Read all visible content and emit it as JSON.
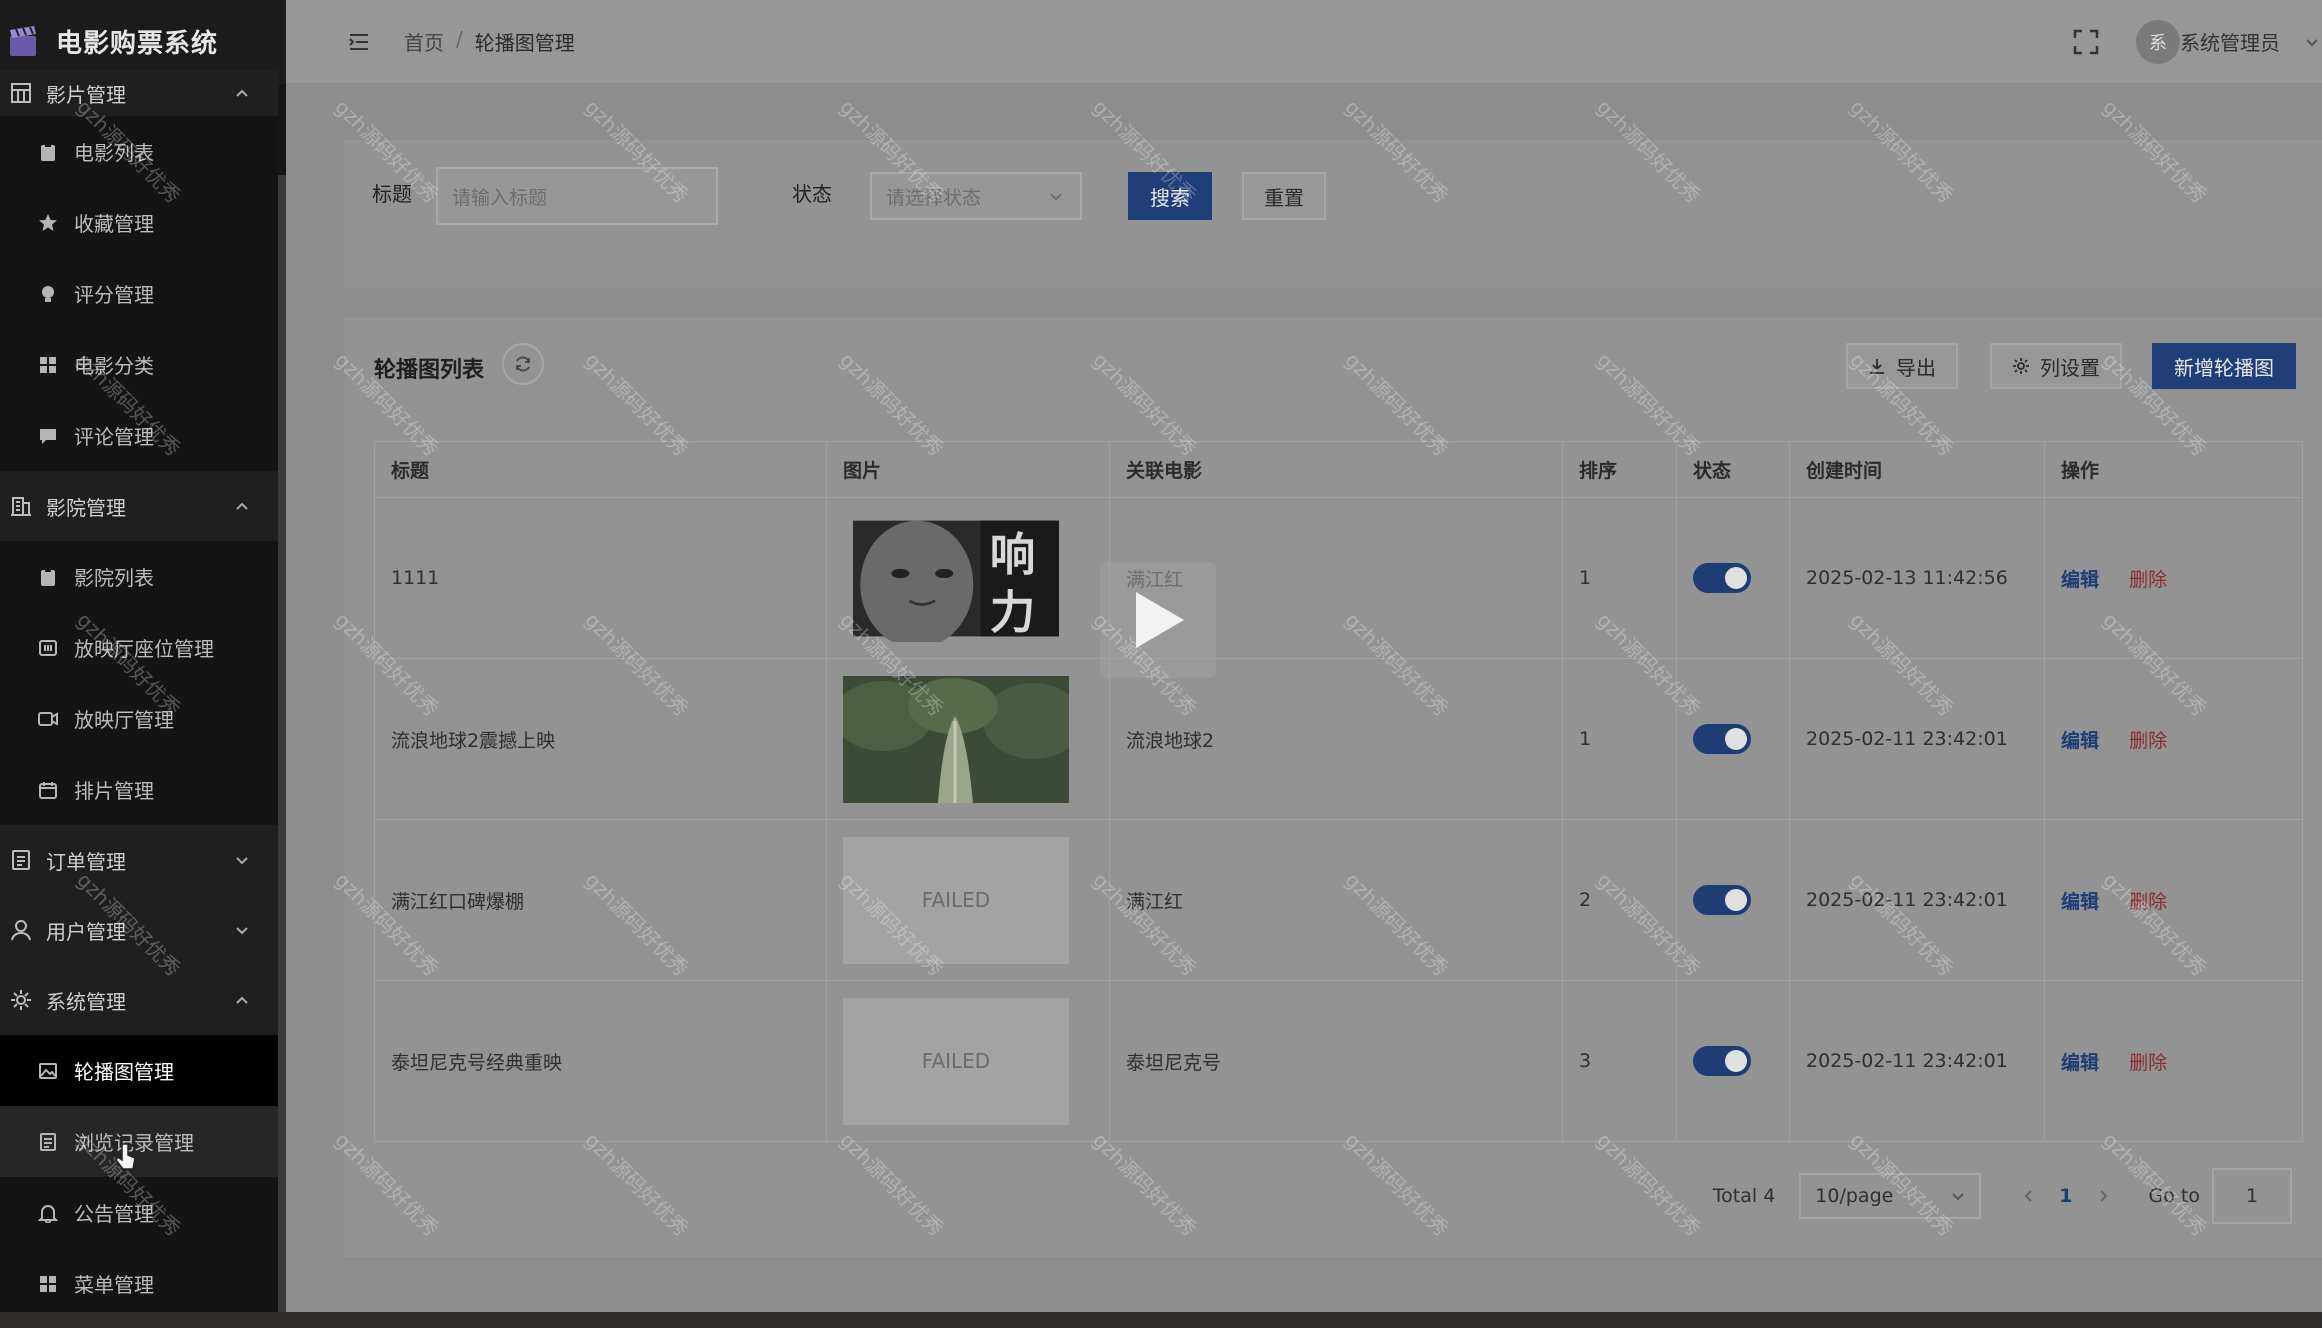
{
  "app": {
    "title": "电影购票系统"
  },
  "sidebar": {
    "groups": [
      {
        "label": "影片管理",
        "icon": "grid-icon",
        "expanded": true,
        "items": [
          {
            "label": "电影列表",
            "icon": "clipboard-icon"
          },
          {
            "label": "收藏管理",
            "icon": "star-icon"
          },
          {
            "label": "评分管理",
            "icon": "bulb-icon"
          },
          {
            "label": "电影分类",
            "icon": "apps-icon"
          },
          {
            "label": "评论管理",
            "icon": "chat-icon"
          }
        ]
      },
      {
        "label": "影院管理",
        "icon": "building-icon",
        "expanded": true,
        "items": [
          {
            "label": "影院列表",
            "icon": "clipboard-icon"
          },
          {
            "label": "放映厅座位管理",
            "icon": "seat-icon"
          },
          {
            "label": "放映厅管理",
            "icon": "camera-icon"
          },
          {
            "label": "排片管理",
            "icon": "calendar-icon"
          }
        ]
      },
      {
        "label": "订单管理",
        "icon": "document-icon",
        "expanded": false
      },
      {
        "label": "用户管理",
        "icon": "user-icon",
        "expanded": false
      },
      {
        "label": "系统管理",
        "icon": "gear-icon",
        "expanded": true,
        "items": [
          {
            "label": "轮播图管理",
            "icon": "image-icon",
            "active": true
          },
          {
            "label": "浏览记录管理",
            "icon": "document-icon"
          },
          {
            "label": "公告管理",
            "icon": "bell-icon"
          },
          {
            "label": "菜单管理",
            "icon": "apps-icon"
          }
        ]
      }
    ]
  },
  "header": {
    "breadcrumb": [
      "首页",
      "轮播图管理"
    ],
    "breadcrumb_sep": "/",
    "avatar_text": "系",
    "user_name": "系统管理员"
  },
  "search": {
    "title_label": "标题",
    "title_placeholder": "请输入标题",
    "status_label": "状态",
    "status_placeholder": "请选择状态",
    "search_btn": "搜索",
    "reset_btn": "重置"
  },
  "list": {
    "title": "轮播图列表",
    "export_btn": "导出",
    "columns_btn": "列设置",
    "add_btn": "新增轮播图",
    "headers": [
      "标题",
      "图片",
      "关联电影",
      "排序",
      "状态",
      "创建时间",
      "操作"
    ],
    "rows": [
      {
        "title": "1111",
        "image": "poster-face",
        "movie": "满江红",
        "sort": "1",
        "status": true,
        "created": "2025-02-13 11:42:56"
      },
      {
        "title": "流浪地球2震撼上映",
        "image": "poster-cabbage",
        "movie": "流浪地球2",
        "sort": "1",
        "status": true,
        "created": "2025-02-11 23:42:01"
      },
      {
        "title": "满江红口碑爆棚",
        "image": "failed",
        "image_text": "FAILED",
        "movie": "满江红",
        "sort": "2",
        "status": true,
        "created": "2025-02-11 23:42:01"
      },
      {
        "title": "泰坦尼克号经典重映",
        "image": "failed",
        "image_text": "FAILED",
        "movie": "泰坦尼克号",
        "sort": "3",
        "status": true,
        "created": "2025-02-11 23:42:01"
      }
    ],
    "actions": {
      "edit": "编辑",
      "delete": "删除"
    }
  },
  "pagination": {
    "total_text": "Total 4",
    "page_size": "10/page",
    "current_page": "1",
    "goto_label": "Go to",
    "goto_value": "1"
  },
  "poster_text": "响力",
  "watermark": "gzh源码好优秀",
  "colors": {
    "primary": "#203f78",
    "danger": "#8a2b2b",
    "sidebar_bg": "#161616"
  }
}
